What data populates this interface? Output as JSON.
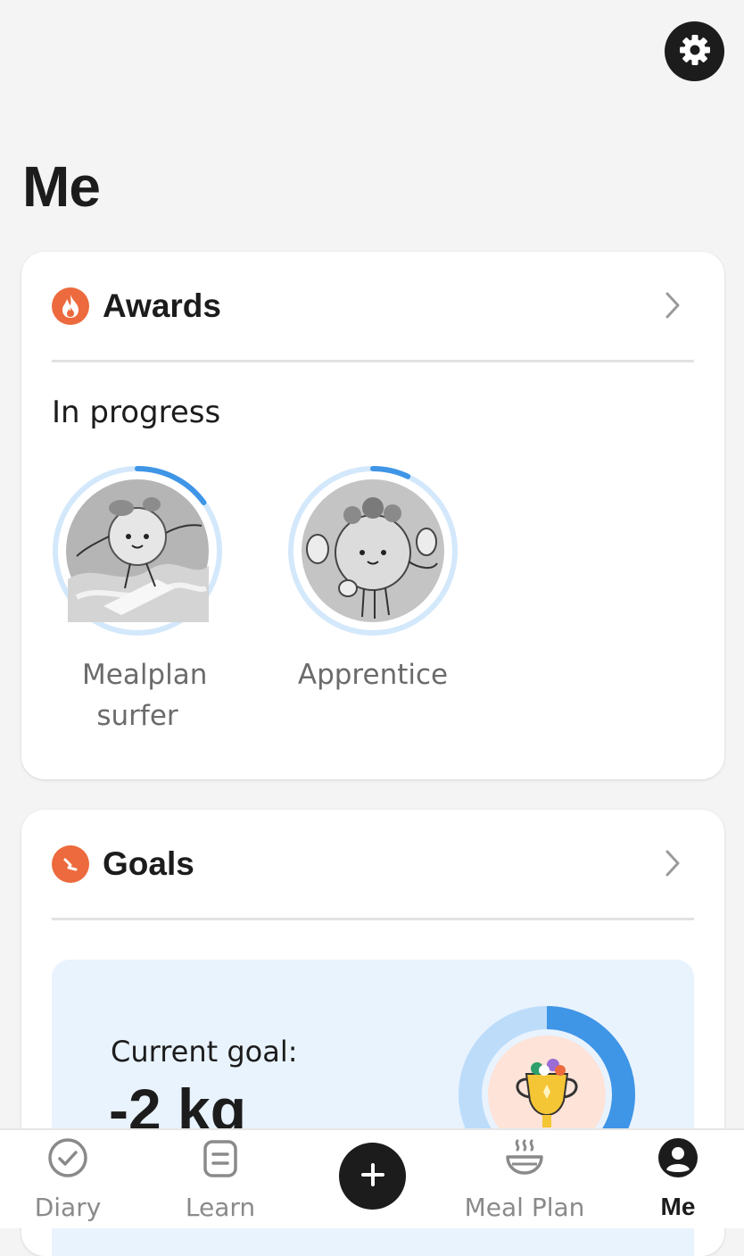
{
  "header": {
    "title": "Me",
    "settings_icon": "gear-icon"
  },
  "awards": {
    "title": "Awards",
    "icon": "flame-icon",
    "accent": "#ec6a3d",
    "section_label": "In progress",
    "items": [
      {
        "name": "Mealplan surfer",
        "progress": 0.15
      },
      {
        "name": "Apprentice",
        "progress": 0.07
      }
    ]
  },
  "goals": {
    "title": "Goals",
    "icon": "goal-icon",
    "accent": "#ec6a3d",
    "current_goal_label": "Current goal:",
    "current_goal_value": "-2 kg",
    "goal_progress": 0.4
  },
  "colors": {
    "progress_blue": "#3f95e6",
    "ring_track": "#cfe6fb",
    "goal_panel": "#e9f3fe"
  },
  "nav": {
    "items": [
      {
        "label": "Diary",
        "icon": "check-circle-icon",
        "active": false
      },
      {
        "label": "Learn",
        "icon": "document-icon",
        "active": false
      },
      {
        "label": "Meal Plan",
        "icon": "bowl-icon",
        "active": false
      },
      {
        "label": "Me",
        "icon": "profile-icon",
        "active": true
      }
    ],
    "add_icon": "plus-icon"
  }
}
